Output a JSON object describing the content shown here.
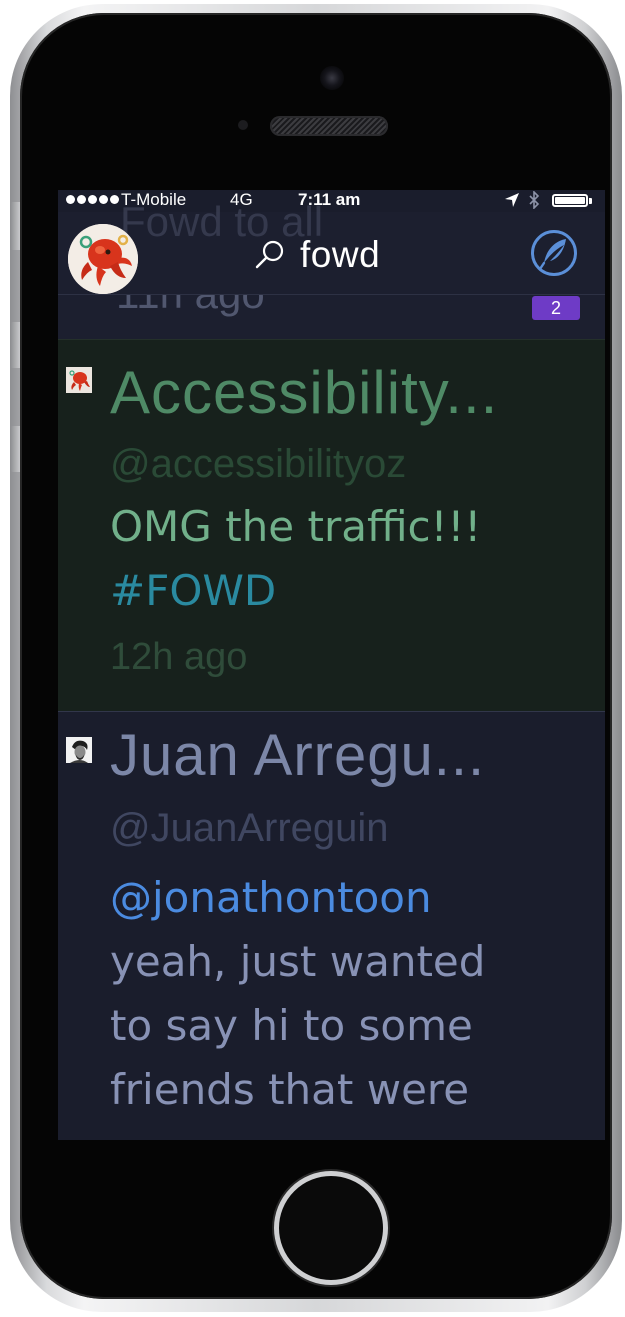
{
  "status_bar": {
    "carrier": "T-Mobile",
    "network": "4G",
    "time": "7:11 am"
  },
  "nav": {
    "ghost_title": "Fowd to all",
    "search_text": "fowd"
  },
  "feed": {
    "partial_time": "11h ago",
    "unread_count": "2",
    "tweets": [
      {
        "name": "Accessibility...",
        "handle": "@accessibilityoz",
        "text": "OMG the traffic!!!",
        "hashtag": "#FOWD",
        "time": "12h ago"
      },
      {
        "name": "Juan Arregu...",
        "handle": "@JuanArreguin",
        "mention": "@jonathontoon",
        "lines": [
          "yeah, just wanted",
          "to say hi to some",
          "friends that were"
        ]
      }
    ]
  },
  "colors": {
    "screen_bg": "#1a1d2c",
    "highlight_bg": "#17211c",
    "accent_blue": "#4b8be0",
    "badge_purple": "#6e3bc6",
    "hashtag_teal": "#2a8aa0"
  }
}
